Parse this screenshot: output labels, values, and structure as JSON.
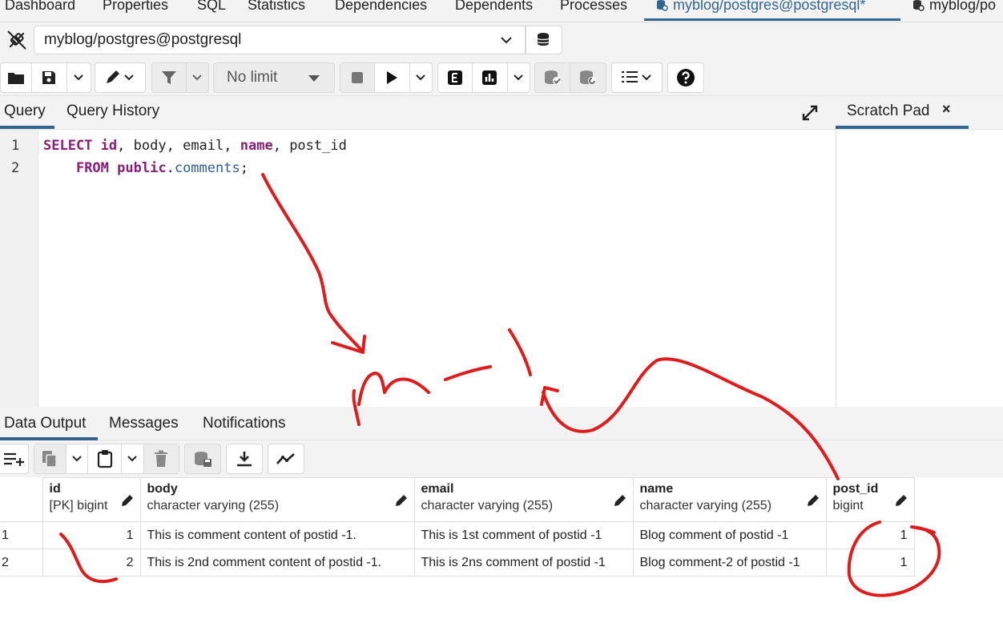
{
  "top_tabs": [
    {
      "label": "Dashboard",
      "active": false
    },
    {
      "label": "Properties",
      "active": false
    },
    {
      "label": "SQL",
      "active": false
    },
    {
      "label": "Statistics",
      "active": false
    },
    {
      "label": "Dependencies",
      "active": false
    },
    {
      "label": "Dependents",
      "active": false
    },
    {
      "label": "Processes",
      "active": false
    },
    {
      "label": "myblog/postgres@postgresql*",
      "active": true
    },
    {
      "label": "myblog/po",
      "active": false
    }
  ],
  "connection": {
    "value": "myblog/postgres@postgresql"
  },
  "toolbar": {
    "limit_value": "No limit"
  },
  "query_tabs": [
    {
      "label": "Query",
      "active": true
    },
    {
      "label": "Query History",
      "active": false
    }
  ],
  "editor": {
    "line_numbers": [
      "1",
      "2"
    ],
    "line1": {
      "kw_select": "SELECT",
      "col_id": "id",
      "sep1": ", ",
      "col_body": "body",
      "sep2": ", ",
      "col_email": "email",
      "sep3": ", ",
      "col_name": "name",
      "sep4": ", ",
      "col_post": "post_id"
    },
    "line2": {
      "indent": "    ",
      "kw_from": "FROM",
      "space": " ",
      "schema": "public",
      "dot": ".",
      "table": "comments",
      "semi": ";"
    }
  },
  "scratch_pad": {
    "title": "Scratch Pad",
    "close": "×"
  },
  "output_tabs": [
    {
      "label": "Data Output",
      "active": true
    },
    {
      "label": "Messages",
      "active": false
    },
    {
      "label": "Notifications",
      "active": false
    }
  ],
  "grid": {
    "columns": [
      {
        "name": "id",
        "type": "[PK] bigint"
      },
      {
        "name": "body",
        "type": "character varying (255)"
      },
      {
        "name": "email",
        "type": "character varying (255)"
      },
      {
        "name": "name",
        "type": "character varying (255)"
      },
      {
        "name": "post_id",
        "type": "bigint"
      }
    ],
    "rows": [
      {
        "rownum": "1",
        "id": "1",
        "body": "This is comment content of postid -1.",
        "email": "This is 1st comment of postid -1",
        "name": "Blog comment of postid -1",
        "post_id": "1"
      },
      {
        "rownum": "2",
        "id": "2",
        "body": "This is  2nd comment content of postid -1.",
        "email": "This is 2ns comment of postid -1",
        "name": "Blog comment-2 of postid -1",
        "post_id": "1"
      }
    ]
  },
  "colors": {
    "accent": "#326690",
    "keyword": "#8a1d78",
    "annotation": "#e01b1b"
  }
}
